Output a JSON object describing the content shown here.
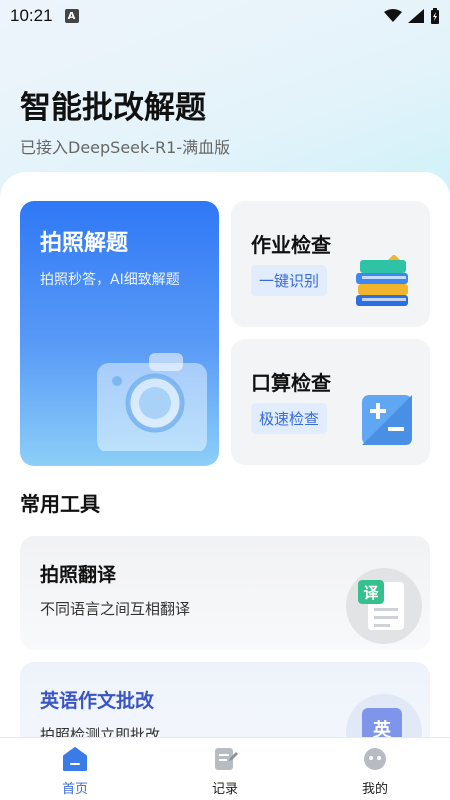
{
  "status_bar": {
    "time": "10:21",
    "notification_badge": "A"
  },
  "header": {
    "title": "智能批改解题",
    "subtitle": "已接入DeepSeek-R1-满血版"
  },
  "main_cards": {
    "photo_solve": {
      "title": "拍照解题",
      "subtitle": "拍照秒答，AI细致解题",
      "icon": "camera-icon"
    },
    "homework_check": {
      "title": "作业检查",
      "tag": "一键识别",
      "icon": "books-icon"
    },
    "mental_math_check": {
      "title": "口算检查",
      "tag": "极速检查",
      "icon": "plus-minus-icon"
    }
  },
  "tools": {
    "section_title": "常用工具",
    "items": [
      {
        "title": "拍照翻译",
        "subtitle": "不同语言之间互相翻译",
        "icon_text": "译"
      },
      {
        "title": "英语作文批改",
        "subtitle": "拍照检测立即批改",
        "icon_text": "英"
      }
    ]
  },
  "tabbar": {
    "items": [
      {
        "label": "首页",
        "icon": "home-icon",
        "active": true
      },
      {
        "label": "记录",
        "icon": "record-icon",
        "active": false
      },
      {
        "label": "我的",
        "icon": "profile-icon",
        "active": false
      }
    ]
  },
  "colors": {
    "accent": "#3a6cd8",
    "photo_card_top": "#2f78f5",
    "photo_card_bottom": "#8ccff7"
  }
}
